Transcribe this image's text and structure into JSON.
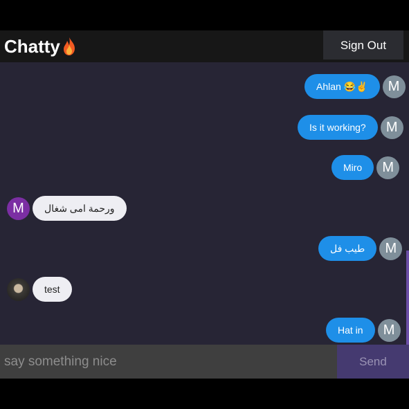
{
  "header": {
    "brand": "Chatty",
    "brand_icon": "fire-icon",
    "sign_out_label": "Sign Out"
  },
  "messages": [
    {
      "text": "Ahlan 😂✌",
      "direction": "out",
      "avatar": "M"
    },
    {
      "text": "Is it working?",
      "direction": "out",
      "avatar": "M"
    },
    {
      "text": "Miro",
      "direction": "out",
      "avatar": "M"
    },
    {
      "text": "ورحمة امى شغال",
      "direction": "in",
      "avatar": "M"
    },
    {
      "text": "طيب فل",
      "direction": "out",
      "avatar": "M"
    },
    {
      "text": "test",
      "direction": "in",
      "avatar": ""
    },
    {
      "text": "Hat in",
      "direction": "out",
      "avatar": "M"
    }
  ],
  "composer": {
    "placeholder": "say something nice",
    "value": "",
    "send_label": "Send"
  },
  "colors": {
    "outgoing_bubble": "#1e8fe8",
    "incoming_bubble": "#eeeef3",
    "background": "#272535",
    "send_button": "#453a70"
  }
}
